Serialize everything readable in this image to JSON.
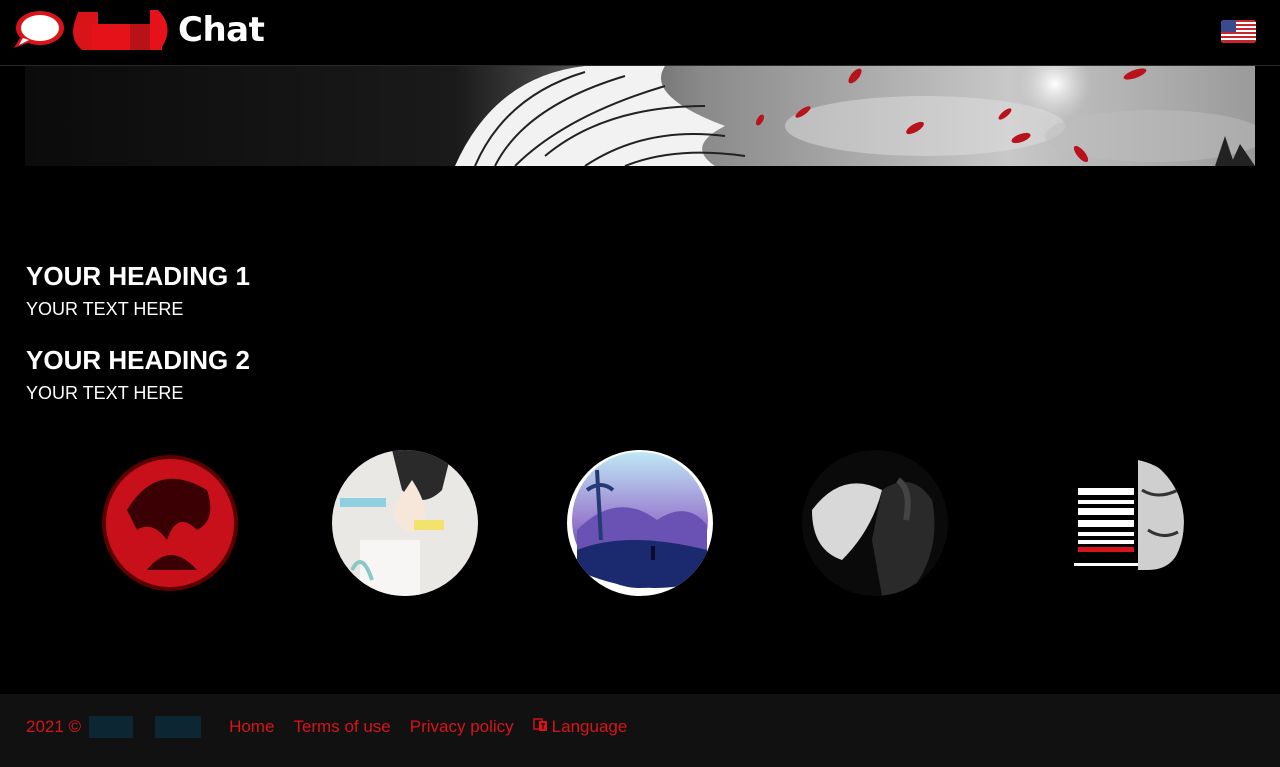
{
  "header": {
    "brand_text": "Chat",
    "language_flag": "us-flag-icon"
  },
  "main": {
    "sections": [
      {
        "heading": "YOUR HEADING 1",
        "text": "YOUR TEXT HERE"
      },
      {
        "heading": "YOUR HEADING 2",
        "text": "YOUR TEXT HERE"
      }
    ]
  },
  "footer": {
    "copyright": "2021 ©",
    "links": {
      "home": "Home",
      "terms": "Terms of use",
      "privacy": "Privacy policy",
      "language": "Language"
    }
  },
  "colors": {
    "accent": "#d8141a",
    "background": "#000000",
    "footer_bg": "#111111"
  }
}
